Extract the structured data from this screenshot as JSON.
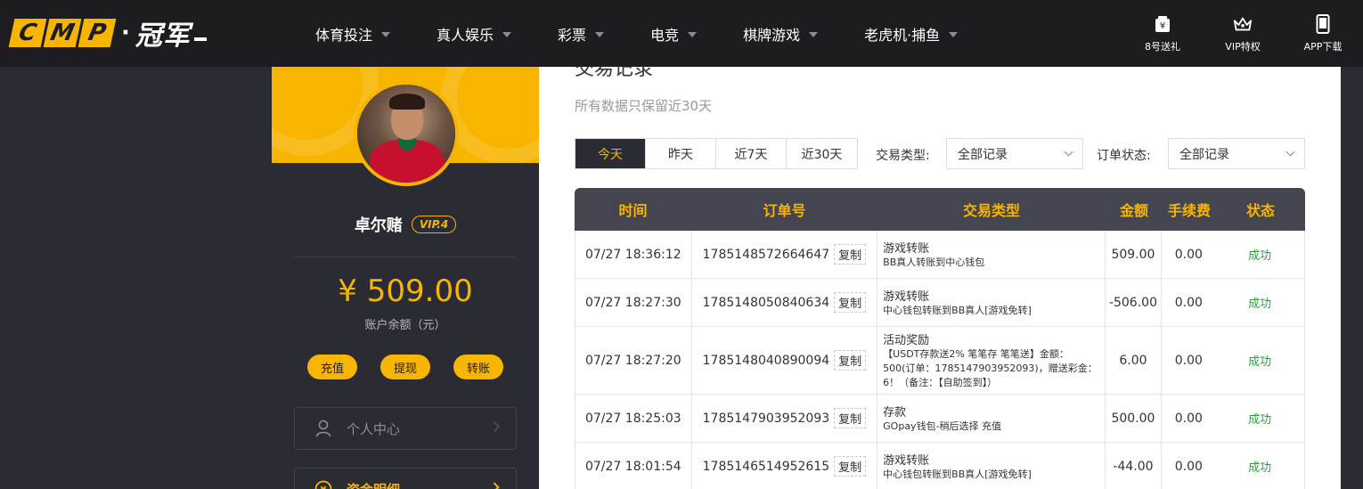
{
  "header": {
    "logo_letters": [
      "C",
      "M",
      "P"
    ],
    "logo_dot": "·",
    "logo_cn": "冠军",
    "nav": [
      {
        "label": "体育投注"
      },
      {
        "label": "真人娱乐"
      },
      {
        "label": "彩票"
      },
      {
        "label": "电竞"
      },
      {
        "label": "棋牌游戏"
      },
      {
        "label": "老虎机·捕鱼"
      }
    ],
    "right": [
      {
        "label": "8号送礼",
        "icon": "gift-yen-icon"
      },
      {
        "label": "VIP特权",
        "icon": "crown-icon"
      },
      {
        "label": "APP下载",
        "icon": "phone-icon"
      }
    ]
  },
  "sidebar": {
    "username": "卓尔赌",
    "vip": "VIP.4",
    "balance": "¥ 509.00",
    "balance_label": "账户余额（元）",
    "actions": [
      {
        "label": "充值"
      },
      {
        "label": "提现"
      },
      {
        "label": "转账"
      }
    ],
    "menu": [
      {
        "label": "个人中心",
        "icon": "user-icon"
      },
      {
        "label": "资金明细",
        "icon": "yen-coin-icon"
      }
    ]
  },
  "main": {
    "title": "交易记录",
    "subtitle": "所有数据只保留近30天",
    "ranges": [
      {
        "label": "今天",
        "active": true
      },
      {
        "label": "昨天"
      },
      {
        "label": "近7天"
      },
      {
        "label": "近30天"
      }
    ],
    "filter_type_label": "交易类型:",
    "filter_type_value": "全部记录",
    "filter_status_label": "订单状态:",
    "filter_status_value": "全部记录",
    "columns": [
      "时间",
      "订单号",
      "交易类型",
      "金额",
      "手续费",
      "状态"
    ],
    "copy_label": "复制",
    "rows": [
      {
        "time": "07/27 18:36:12",
        "order": "1785148572664647",
        "type": "游戏转账",
        "detail": "BB真人转账到中心钱包",
        "amount": "509.00",
        "fee": "0.00",
        "status": "成功"
      },
      {
        "time": "07/27 18:27:30",
        "order": "1785148050840634",
        "type": "游戏转账",
        "detail": "中心钱包转账到BB真人[游戏免转]",
        "amount": "-506.00",
        "fee": "0.00",
        "status": "成功"
      },
      {
        "time": "07/27 18:27:20",
        "order": "1785148040890094",
        "type": "活动奖励",
        "detail": "【USDT存款送2% 笔笔存 笔笔送】金额：500(订单：1785147903952093)，赠送彩金：6！（备注：【自助签到】）",
        "amount": "6.00",
        "fee": "0.00",
        "status": "成功"
      },
      {
        "time": "07/27 18:25:03",
        "order": "1785147903952093",
        "type": "存款",
        "detail": "GOpay钱包-稍后选择 充值",
        "amount": "500.00",
        "fee": "0.00",
        "status": "成功"
      },
      {
        "time": "07/27 18:01:54",
        "order": "1785146514952615",
        "type": "游戏转账",
        "detail": "中心钱包转账到BB真人[游戏免转]",
        "amount": "-44.00",
        "fee": "0.00",
        "status": "成功"
      }
    ]
  },
  "colors": {
    "accent": "#f7b500",
    "dark": "#2b2b33",
    "success": "#2aa23c"
  }
}
